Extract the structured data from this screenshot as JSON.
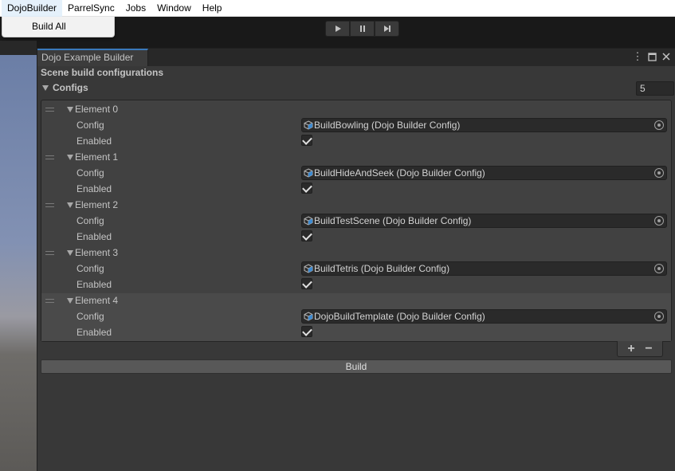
{
  "menubar": {
    "items": [
      "DojoBuilder",
      "ParrelSync",
      "Jobs",
      "Window",
      "Help"
    ]
  },
  "dropdown": {
    "items": [
      "Build All"
    ]
  },
  "window": {
    "tab_title": "Dojo Example Builder",
    "heading": "Scene build configurations",
    "configs_label": "Configs",
    "configs_size": "5",
    "config_label": "Config",
    "enabled_label": "Enabled",
    "elements": [
      {
        "label": "Element 0",
        "config": "BuildBowling (Dojo Builder Config)",
        "enabled": true
      },
      {
        "label": "Element 1",
        "config": "BuildHideAndSeek (Dojo Builder Config)",
        "enabled": true
      },
      {
        "label": "Element 2",
        "config": "BuildTestScene (Dojo Builder Config)",
        "enabled": true
      },
      {
        "label": "Element 3",
        "config": "BuildTetris (Dojo Builder Config)",
        "enabled": true
      },
      {
        "label": "Element 4",
        "config": "DojoBuildTemplate (Dojo Builder Config)",
        "enabled": true
      }
    ],
    "add_label": "+",
    "remove_label": "−",
    "build_label": "Build"
  },
  "colors": {
    "accent": "#3a79bb",
    "window_bg": "#383838",
    "field_bg": "#2a2a2a"
  }
}
